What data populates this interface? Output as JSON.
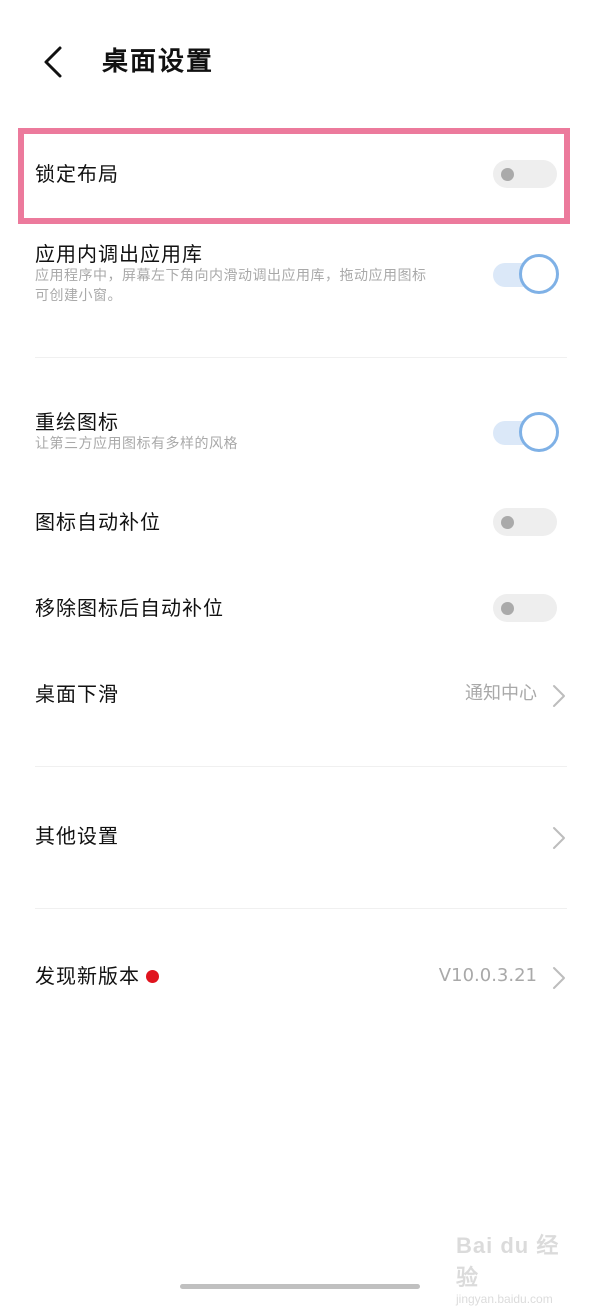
{
  "header": {
    "title": "桌面设置"
  },
  "rows": [
    {
      "title": "锁定布局",
      "toggle": "off"
    },
    {
      "title": "应用内调出应用库",
      "subtitle_line1": "应用程序中，屏幕左下角向内滑动调出应用库，拖动应用图标",
      "subtitle_line2": "可创建小窗。",
      "toggle": "on"
    },
    {
      "title": "重绘图标",
      "subtitle": "让第三方应用图标有多样的风格",
      "toggle": "on"
    },
    {
      "title": "图标自动补位",
      "toggle": "off"
    },
    {
      "title": "移除图标后自动补位",
      "toggle": "off"
    },
    {
      "title": "桌面下滑",
      "value": "通知中心"
    },
    {
      "title": "其他设置"
    },
    {
      "title": "发现新版本",
      "value": "V10.0.3.21",
      "badge_color": "#e0141e"
    }
  ],
  "colors": {
    "highlight_border": "#ec7a9c",
    "toggle_on_accent": "#7fb1e6"
  },
  "watermark": {
    "brand": "Bai du 经验",
    "url": "jingyan.baidu.com"
  }
}
